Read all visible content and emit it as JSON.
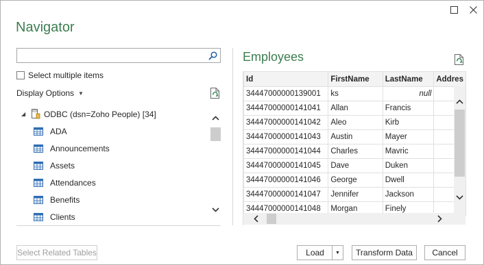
{
  "window": {
    "minimize_glyph": "☐",
    "close_glyph": "✕"
  },
  "title": "Navigator",
  "search": {
    "placeholder": "",
    "value": ""
  },
  "select_multiple": {
    "label": "Select multiple items",
    "checked": false
  },
  "display_options": {
    "label": "Display Options"
  },
  "tree": {
    "root": {
      "label": "ODBC (dsn=Zoho People) [34]",
      "icon": "database-icon",
      "expanded": true
    },
    "items": [
      {
        "label": "ADA",
        "icon": "table-icon"
      },
      {
        "label": "Announcements",
        "icon": "table-icon"
      },
      {
        "label": "Assets",
        "icon": "table-icon"
      },
      {
        "label": "Attendances",
        "icon": "table-icon"
      },
      {
        "label": "Benefits",
        "icon": "table-icon"
      },
      {
        "label": "Clients",
        "icon": "table-icon"
      }
    ]
  },
  "preview": {
    "title": "Employees",
    "columns": [
      "Id",
      "FirstName",
      "LastName",
      "Addres"
    ],
    "rows": [
      [
        "34447000000139001",
        "ks",
        "null",
        ""
      ],
      [
        "34447000000141041",
        "Allan",
        "Francis",
        ""
      ],
      [
        "34447000000141042",
        "Aleo",
        "Kirb",
        ""
      ],
      [
        "34447000000141043",
        "Austin",
        "Mayer",
        ""
      ],
      [
        "34447000000141044",
        "Charles",
        "Mavric",
        ""
      ],
      [
        "34447000000141045",
        "Dave",
        "Duken",
        ""
      ],
      [
        "34447000000141046",
        "George",
        "Dwell",
        ""
      ],
      [
        "34447000000141047",
        "Jennifer",
        "Jackson",
        ""
      ],
      [
        "34447000000141048",
        "Morgan",
        "Finely",
        ""
      ]
    ]
  },
  "footer": {
    "select_related": "Select Related Tables",
    "load": "Load",
    "transform": "Transform Data",
    "cancel": "Cancel"
  },
  "colors": {
    "accent": "#3c7d4f"
  }
}
